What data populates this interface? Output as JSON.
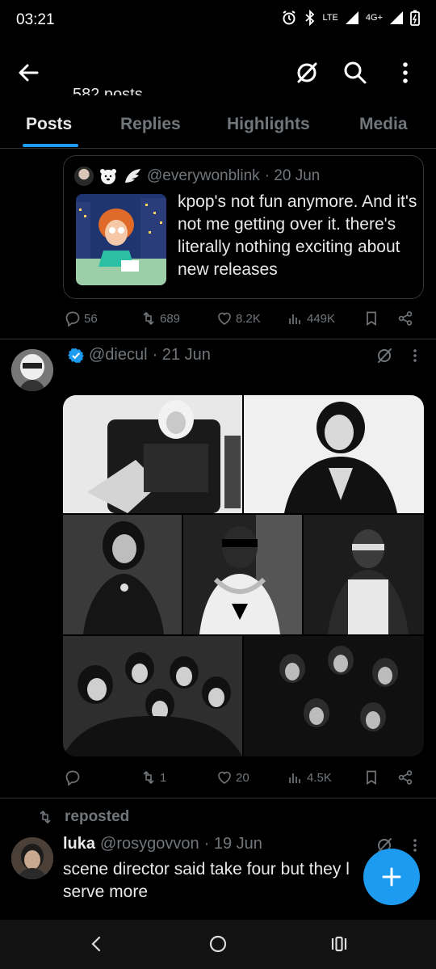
{
  "status_bar": {
    "time": "03:21",
    "net_label": "LTE",
    "net2_label": "4G+"
  },
  "header": {
    "post_count": "582 posts"
  },
  "tabs": [
    {
      "label": "Posts",
      "active": true
    },
    {
      "label": "Replies",
      "active": false
    },
    {
      "label": "Highlights",
      "active": false
    },
    {
      "label": "Media",
      "active": false
    }
  ],
  "quoted_tweet": {
    "handle": "@everywonblink",
    "date": "· 20 Jun",
    "text": "kpop's not fun anymore. And it's not me getting over it. there's literally nothing exciting about new releases"
  },
  "tweet1_actions": {
    "replies": "56",
    "reposts": "689",
    "likes": "8.2K",
    "views": "449K"
  },
  "tweet2": {
    "handle": "@diecul",
    "date": "· 21 Jun",
    "actions": {
      "replies": "",
      "reposts": "1",
      "likes": "20",
      "views": "4.5K"
    }
  },
  "tweet3": {
    "repost_label": "reposted",
    "name": "luka",
    "handle": "@rosygovvon",
    "date": "· 19 Jun",
    "text": "scene director said take four but they l serve more"
  },
  "colors": {
    "accent": "#1d9bf0",
    "muted": "#71767b",
    "text": "#e7e9ea",
    "border": "#2f3336"
  }
}
